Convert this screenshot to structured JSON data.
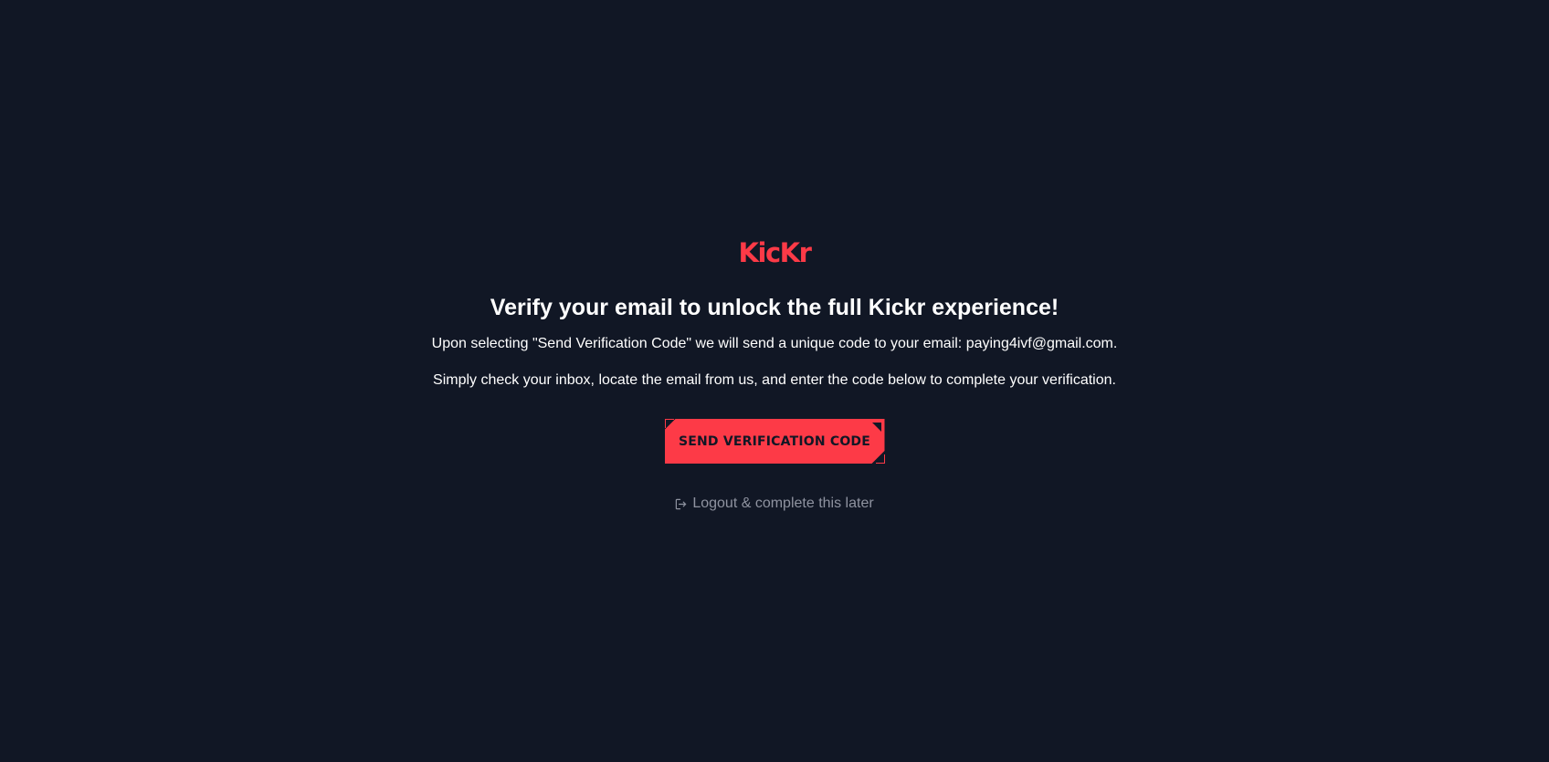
{
  "brand": {
    "logo_text": "KicKr",
    "accent_color": "#fd3a47",
    "background_color": "#111725"
  },
  "verify": {
    "headline": "Verify your email to unlock the full Kickr experience!",
    "description_1": "Upon selecting \"Send Verification Code\" we will send a unique code to your email: paying4ivf@gmail.com.",
    "description_2": "Simply check your inbox, locate the email from us, and enter the code below to complete your verification.",
    "send_button_label": "SEND VERIFICATION CODE",
    "logout_label": "Logout & complete this later",
    "logout_icon": "logout-icon"
  }
}
